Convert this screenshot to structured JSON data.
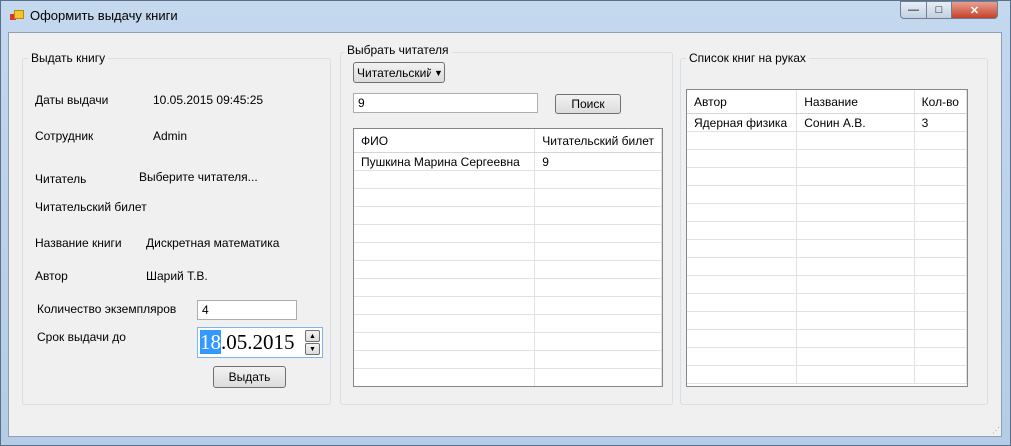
{
  "window": {
    "title": "Оформить выдачу книги",
    "minimize": "—",
    "maximize": "□",
    "close": "✕"
  },
  "issue": {
    "group": "Выдать книгу",
    "date_label": "Даты выдачи",
    "date_value": "10.05.2015 09:45:25",
    "employee_label": "Сотрудник",
    "employee_value": "Admin",
    "reader_label": "Читатель",
    "reader_value": "Выберите читателя...",
    "card_label": "Читательский билет",
    "book_label": "Название книги",
    "book_value": "Дискретная математика",
    "author_label": "Автор",
    "author_value": "Шарий Т.В.",
    "count_label": "Количество экземпляров",
    "count_value": "4",
    "due_label": "Срок выдачи до",
    "due_day": "18",
    "due_rest": ".05.2015",
    "submit": "Выдать"
  },
  "reader": {
    "group": "Выбрать читателя",
    "filter": "Читательский",
    "search_value": "9",
    "search_button": "Поиск",
    "columns": [
      "ФИО",
      "Читательский билет"
    ],
    "rows": [
      [
        "Пушкина Марина Сергеевна",
        "9"
      ]
    ]
  },
  "books": {
    "group": "Список книг на руках",
    "columns": [
      "Автор",
      "Название",
      "Кол-во"
    ],
    "rows": [
      [
        "Ядерная физика",
        "Сонин А.В.",
        "3"
      ]
    ]
  }
}
